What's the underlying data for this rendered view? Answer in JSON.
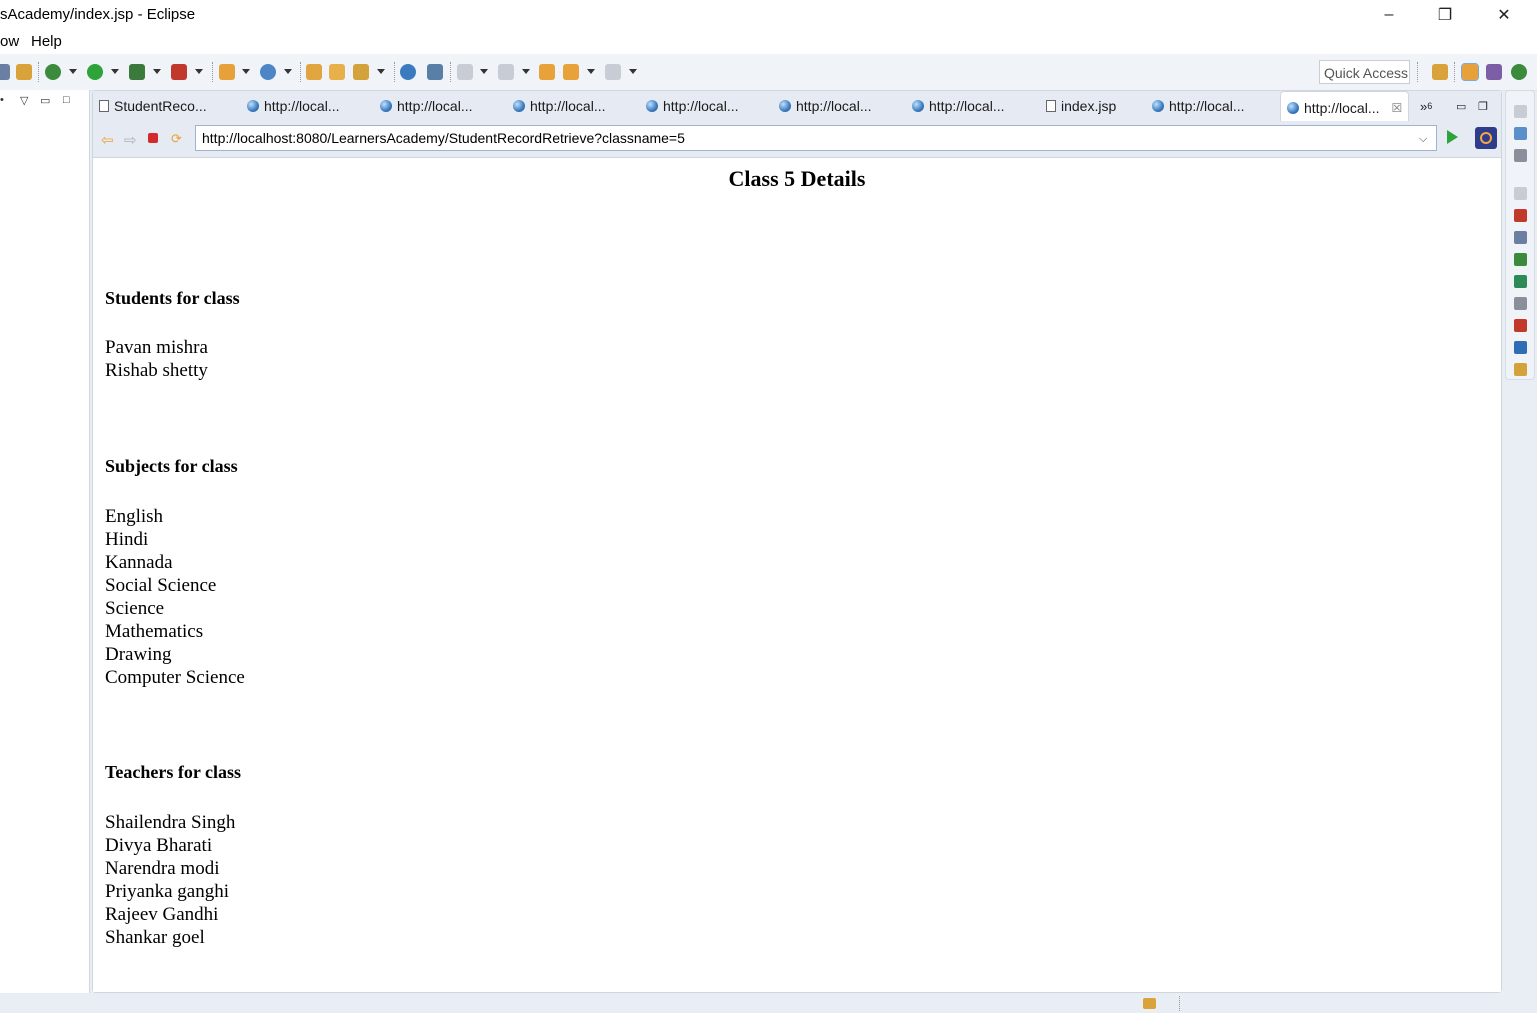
{
  "window": {
    "title": "sAcademy/index.jsp - Eclipse",
    "controls": {
      "minimize": "–",
      "maximize": "❐",
      "close": "✕"
    }
  },
  "menu": {
    "items": [
      "ow",
      "Help"
    ]
  },
  "toolbar": {
    "quick_access": "Quick Access"
  },
  "tabs": [
    {
      "label": "StudentReco...",
      "icon": "jsp-file-icon"
    },
    {
      "label": "http://local...",
      "icon": "globe-icon"
    },
    {
      "label": "http://local...",
      "icon": "globe-icon"
    },
    {
      "label": "http://local...",
      "icon": "globe-icon"
    },
    {
      "label": "http://local...",
      "icon": "globe-icon"
    },
    {
      "label": "http://local...",
      "icon": "globe-icon"
    },
    {
      "label": "http://local...",
      "icon": "globe-icon"
    },
    {
      "label": "index.jsp",
      "icon": "jsp-file-icon"
    },
    {
      "label": "http://local...",
      "icon": "globe-icon"
    },
    {
      "label": "http://local...",
      "icon": "globe-icon",
      "active": true
    }
  ],
  "tab_overflow": {
    "label": "»",
    "count": "6"
  },
  "browser": {
    "url": "http://localhost:8080/LearnersAcademy/StudentRecordRetrieve?classname=5"
  },
  "page": {
    "title": "Class 5 Details",
    "students_heading": "Students for class",
    "students": [
      "Pavan mishra",
      "Rishab shetty"
    ],
    "subjects_heading": "Subjects for class",
    "subjects": [
      "English",
      "Hindi",
      "Kannada",
      "Social Science",
      "Science",
      "Mathematics",
      "Drawing",
      "Computer Science"
    ],
    "teachers_heading": "Teachers for class",
    "teachers": [
      "Shailendra Singh",
      "Divya Bharati",
      "Narendra modi",
      "Priyanka ganghi",
      "Rajeev Gandhi",
      "Shankar goel"
    ]
  },
  "colors": {
    "accent": "#2e3c8c",
    "run_green": "#2ea33a",
    "stop_red": "#d22b2b",
    "nav_orange": "#e8a23a"
  }
}
